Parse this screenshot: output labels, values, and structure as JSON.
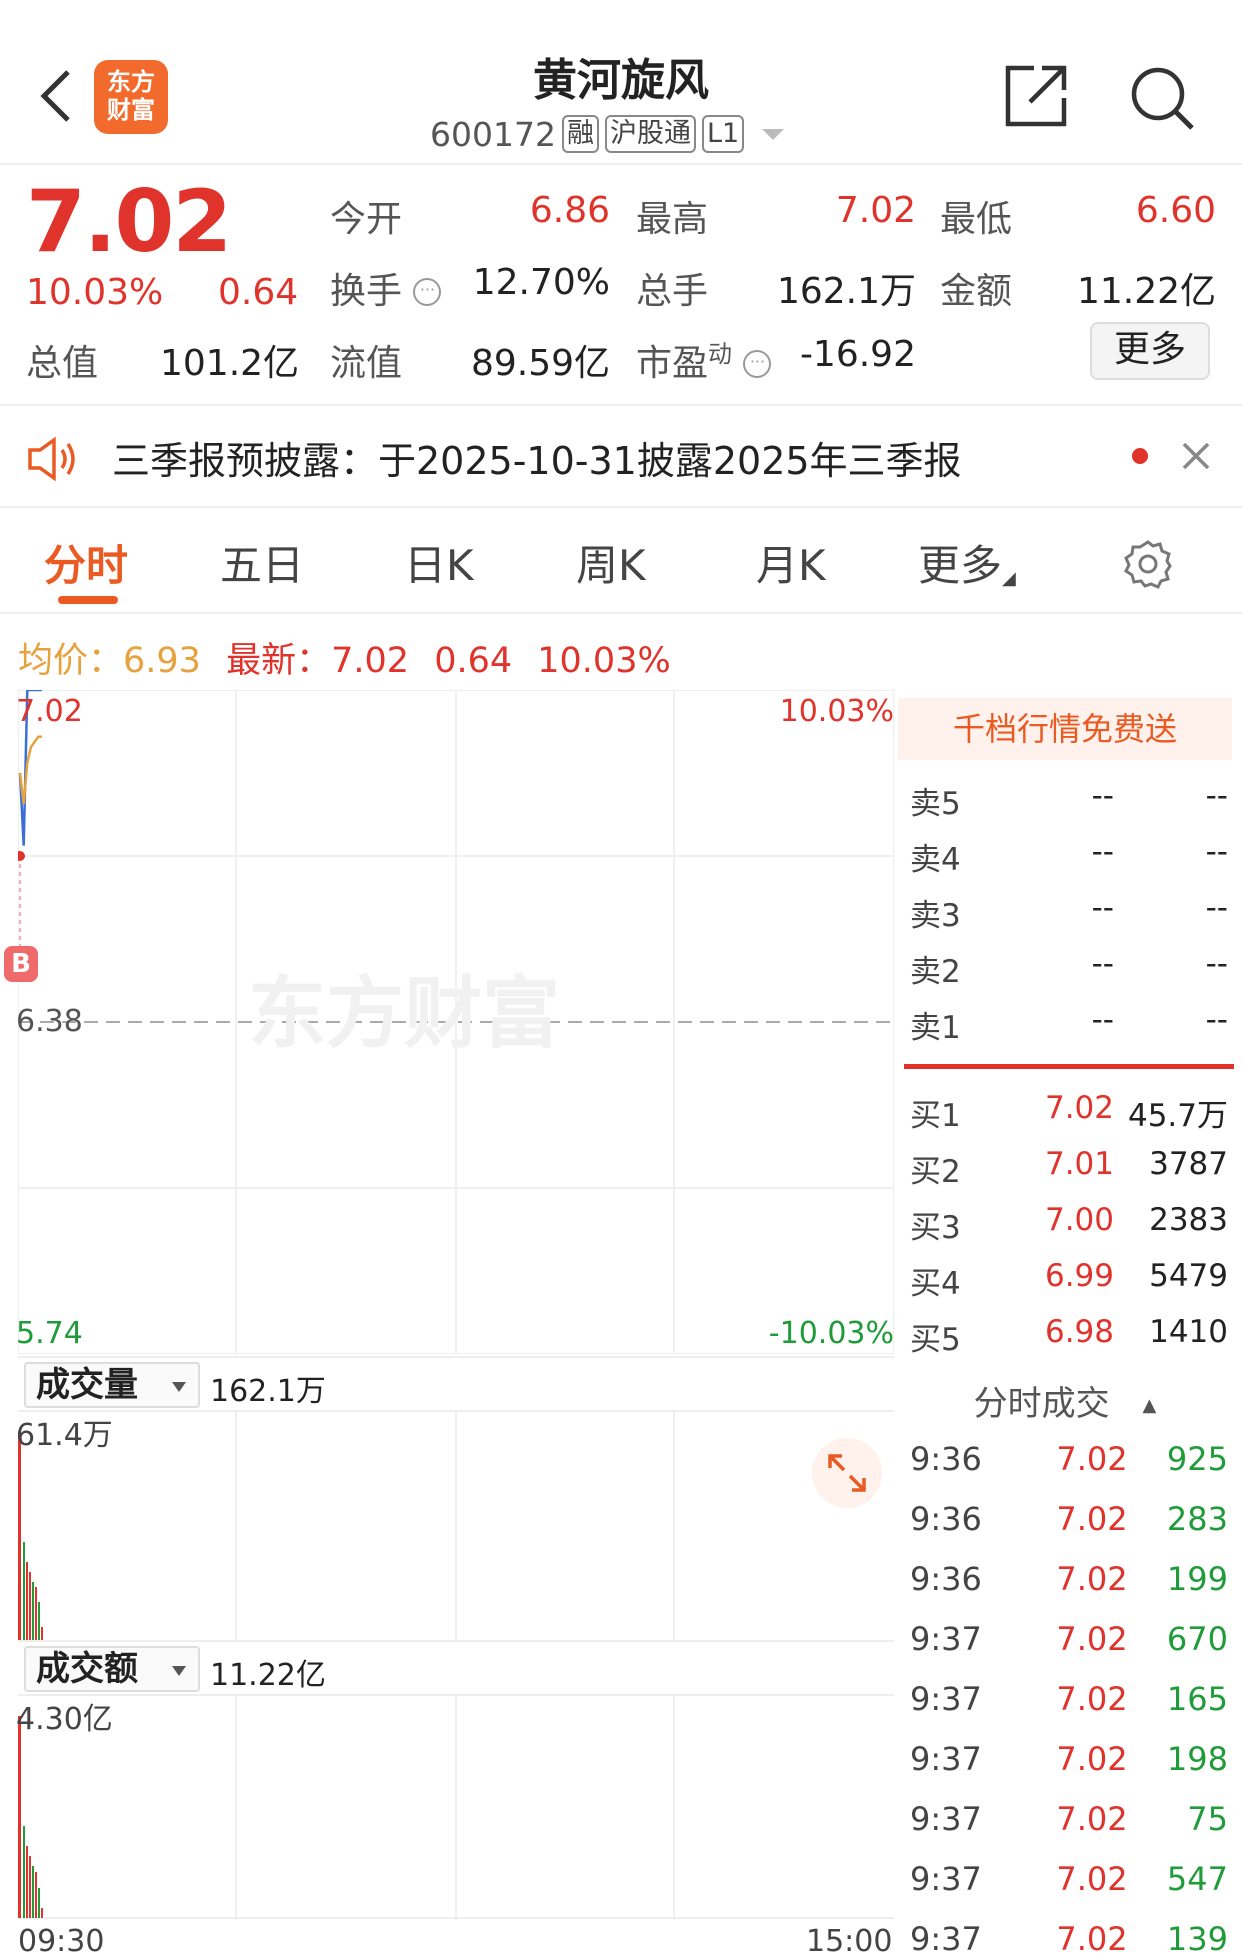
{
  "header": {
    "title": "黄河旋风",
    "code": "600172",
    "tags": [
      "融",
      "沪股通",
      "L1"
    ],
    "logo_text_1": "东方",
    "logo_text_2": "财富"
  },
  "quote": {
    "price": "7.02",
    "change_pct": "10.03%",
    "change": "0.64",
    "open_label": "今开",
    "open": "6.86",
    "high_label": "最高",
    "high": "7.02",
    "low_label": "最低",
    "low": "6.60",
    "turnover_label": "换手",
    "turnover": "12.70%",
    "volume_label": "总手",
    "volume": "162.1万",
    "amount_label": "金额",
    "amount": "11.22亿",
    "mcap_label": "总值",
    "mcap": "101.2亿",
    "float_label": "流值",
    "float": "89.59亿",
    "pe_label": "市盈",
    "pe_sup": "动",
    "pe": "-16.92",
    "more": "更多"
  },
  "notice": {
    "text": "三季报预披露：于2025-10-31披露2025年三季报"
  },
  "tabs": [
    "分时",
    "五日",
    "日K",
    "周K",
    "月K",
    "更多"
  ],
  "summary": {
    "avg_label": "均价：",
    "avg": "6.93",
    "latest_label": "最新：",
    "latest": "7.02",
    "change": "0.64",
    "pct": "10.03%"
  },
  "chart": {
    "y_top": "7.02",
    "y_mid": "6.38",
    "y_bot": "5.74",
    "pct_top": "10.03%",
    "pct_bot": "-10.03%",
    "buy_marker": "B",
    "watermark": "东方财富",
    "volume_label": "成交量",
    "volume_total": "162.1万",
    "volume_max": "61.4万",
    "amount_label": "成交额",
    "amount_total": "11.22亿",
    "amount_max": "4.30亿",
    "time_start": "09:30",
    "time_end": "15:00"
  },
  "chart_data": {
    "type": "line",
    "title": "",
    "xlabel": "",
    "ylabel": "",
    "ylim": [
      5.74,
      7.02
    ],
    "x": [
      "09:30",
      "09:31",
      "09:32",
      "09:33",
      "09:34",
      "09:35",
      "09:36"
    ],
    "series": [
      {
        "values": [
          6.86,
          6.72,
          7.02,
          7.02,
          7.02,
          7.02,
          7.02
        ]
      },
      {
        "values": [
          6.86,
          6.8,
          6.88,
          6.91,
          6.92,
          6.93,
          6.93
        ]
      }
    ]
  },
  "orderbook": {
    "promo": "千档行情免费送",
    "asks": [
      {
        "label": "卖5",
        "price": "--",
        "vol": "--"
      },
      {
        "label": "卖4",
        "price": "--",
        "vol": "--"
      },
      {
        "label": "卖3",
        "price": "--",
        "vol": "--"
      },
      {
        "label": "卖2",
        "price": "--",
        "vol": "--"
      },
      {
        "label": "卖1",
        "price": "--",
        "vol": "--"
      }
    ],
    "bids": [
      {
        "label": "买1",
        "price": "7.02",
        "vol": "45.7万"
      },
      {
        "label": "买2",
        "price": "7.01",
        "vol": "3787"
      },
      {
        "label": "买3",
        "price": "7.00",
        "vol": "2383"
      },
      {
        "label": "买4",
        "price": "6.99",
        "vol": "5479"
      },
      {
        "label": "买5",
        "price": "6.98",
        "vol": "1410"
      }
    ]
  },
  "trades": {
    "header": "分时成交",
    "rows": [
      {
        "time": "9:36",
        "price": "7.02",
        "vol": "925"
      },
      {
        "time": "9:36",
        "price": "7.02",
        "vol": "283"
      },
      {
        "time": "9:36",
        "price": "7.02",
        "vol": "199"
      },
      {
        "time": "9:37",
        "price": "7.02",
        "vol": "670"
      },
      {
        "time": "9:37",
        "price": "7.02",
        "vol": "165"
      },
      {
        "time": "9:37",
        "price": "7.02",
        "vol": "198"
      },
      {
        "time": "9:37",
        "price": "7.02",
        "vol": "75"
      },
      {
        "time": "9:37",
        "price": "7.02",
        "vol": "547"
      },
      {
        "time": "9:37",
        "price": "7.02",
        "vol": "139"
      }
    ]
  },
  "colors": {
    "up": "#e0332b",
    "down": "#1f9b3a",
    "accent": "#ea5a22",
    "avg": "#e6a23c",
    "price_line": "#3a6fd8"
  }
}
